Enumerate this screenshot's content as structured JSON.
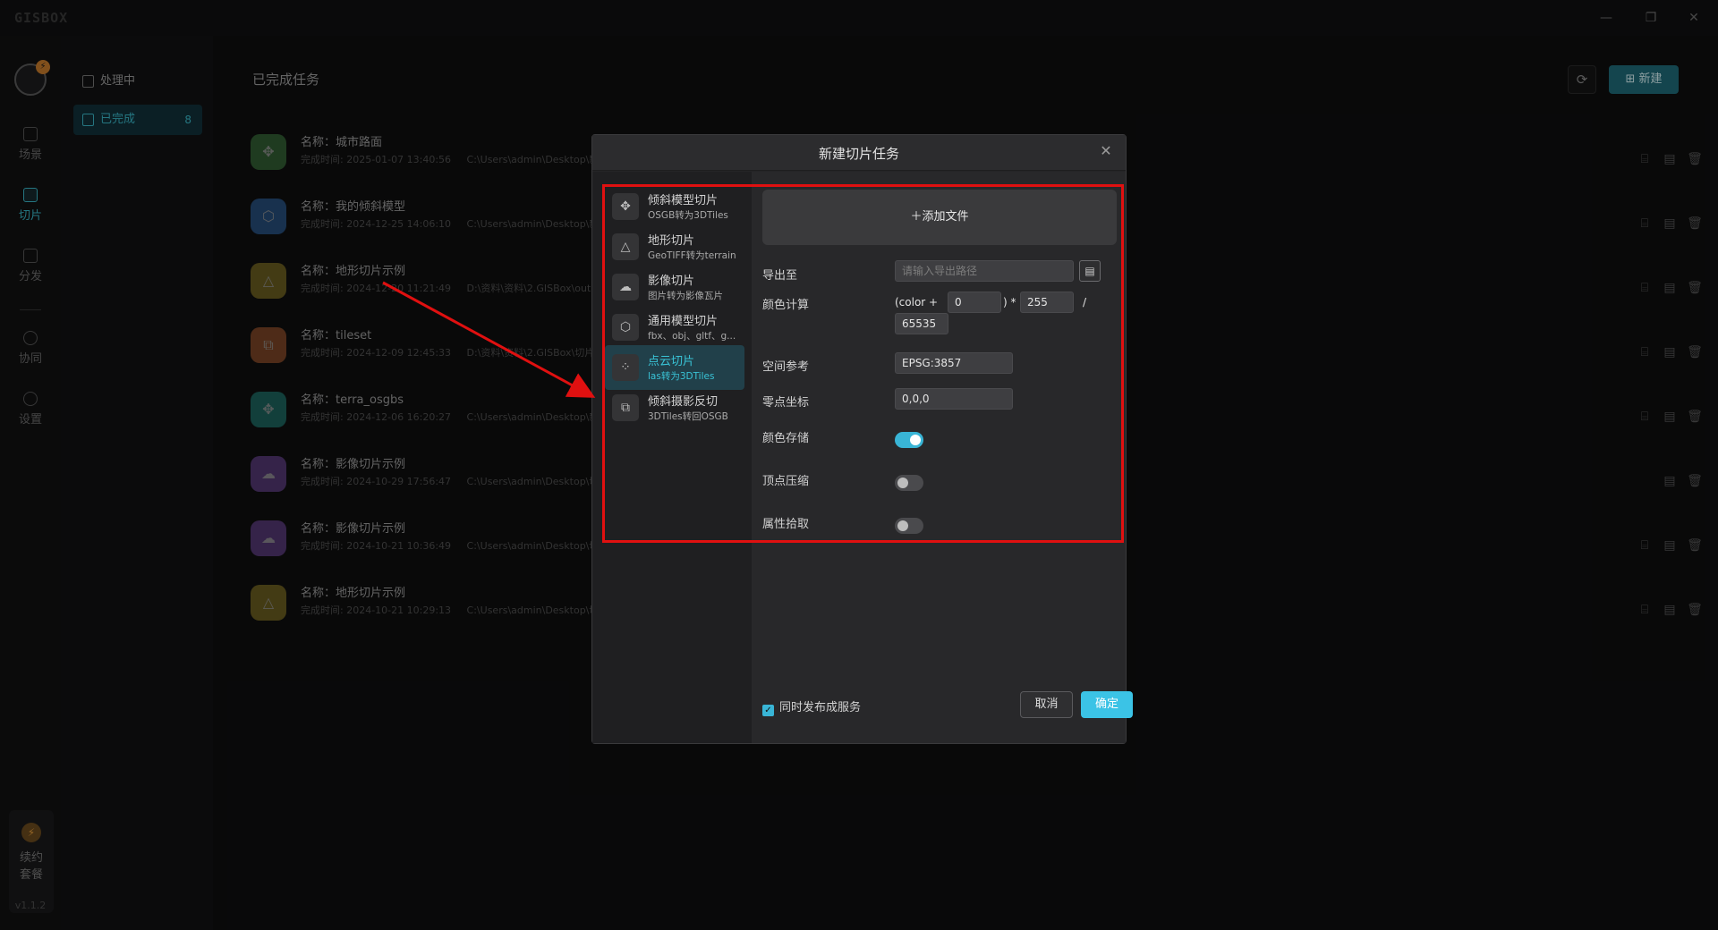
{
  "app": {
    "logo": "GISBOX",
    "window_controls": {
      "minimize": "—",
      "restore": "❐",
      "close": "✕"
    },
    "version": "v1.1.2"
  },
  "rail": {
    "items": [
      {
        "label": "场景",
        "icon": "scene-icon"
      },
      {
        "label": "切片",
        "icon": "slice-icon",
        "active": true
      },
      {
        "label": "分发",
        "icon": "distribute-icon"
      },
      {
        "label": "协同",
        "icon": "collab-icon"
      },
      {
        "label": "设置",
        "icon": "settings-icon"
      }
    ],
    "renew_label_1": "续约",
    "renew_label_2": "套餐"
  },
  "subnav": {
    "processing": "处理中",
    "done": "已完成",
    "done_count": "8"
  },
  "main": {
    "title": "已完成任务",
    "new_label": "新建",
    "time_label": "完成时间:",
    "tasks": [
      {
        "name": "名称：城市路面",
        "time": "2025-01-07 13:40:56",
        "path": "C:\\Users\\admin\\Desktop\\新建",
        "color": "#4f9a4f",
        "glyph": "✥",
        "actions": 3
      },
      {
        "name": "名称：我的倾斜模型",
        "time": "2024-12-25 14:06:10",
        "path": "C:\\Users\\admin\\Desktop\\新建",
        "color": "#3a7fd0",
        "glyph": "⬡",
        "actions": 3
      },
      {
        "name": "名称：地形切片示例",
        "time": "2024-12-20 11:21:49",
        "path": "D:\\资料\\资料\\2.GISBox\\out",
        "color": "#b19a2e",
        "glyph": "△",
        "actions": 3
      },
      {
        "name": "名称：tileset",
        "time": "2024-12-09 12:45:33",
        "path": "D:\\资料\\资料\\2.GISBox\\切片\\",
        "color": "#d0703a",
        "glyph": "⧉",
        "actions": 3
      },
      {
        "name": "名称：terra_osgbs",
        "time": "2024-12-06 16:20:27",
        "path": "C:\\Users\\admin\\Desktop\\新建",
        "color": "#2aa89a",
        "glyph": "✥",
        "actions": 3
      },
      {
        "name": "名称：影像切片示例",
        "time": "2024-10-29 17:56:47",
        "path": "C:\\Users\\admin\\Desktop\\切片",
        "color": "#8a5ac0",
        "glyph": "☁",
        "actions": 2
      },
      {
        "name": "名称：影像切片示例",
        "time": "2024-10-21 10:36:49",
        "path": "C:\\Users\\admin\\Desktop\\切片",
        "color": "#8a5ac0",
        "glyph": "☁",
        "actions": 3
      },
      {
        "name": "名称：地形切片示例",
        "time": "2024-10-21 10:29:13",
        "path": "C:\\Users\\admin\\Desktop\\切片\\",
        "color": "#b19a2e",
        "glyph": "△",
        "actions": 3
      }
    ]
  },
  "dialog": {
    "title": "新建切片任务",
    "options": [
      {
        "title": "倾斜模型切片",
        "sub": "OSGB转为3DTiles",
        "glyph": "✥"
      },
      {
        "title": "地形切片",
        "sub": "GeoTIFF转为terrain",
        "glyph": "△"
      },
      {
        "title": "影像切片",
        "sub": "图片转为影像瓦片",
        "glyph": "☁"
      },
      {
        "title": "通用模型切片",
        "sub": "fbx、obj、gltf、g...",
        "glyph": "⬡"
      },
      {
        "title": "点云切片",
        "sub": "las转为3DTiles",
        "glyph": "⁘",
        "active": true
      },
      {
        "title": "倾斜摄影反切",
        "sub": "3DTiles转回OSGB",
        "glyph": "⧉"
      }
    ],
    "add_file": "＋添加文件",
    "export_label": "导出至",
    "export_placeholder": "请输入导出路径",
    "color_calc_label": "颜色计算",
    "color_calc_prefix": "(color +",
    "color_calc_a": "0",
    "color_calc_mid": ") *",
    "color_calc_b": "255",
    "color_calc_div": "/",
    "color_calc_c": "65535",
    "srs_label": "空间参考",
    "srs_value": "EPSG:3857",
    "origin_label": "零点坐标",
    "origin_value": "0,0,0",
    "color_store_label": "颜色存储",
    "color_store_on": true,
    "vertex_compress_label": "顶点压缩",
    "vertex_compress_on": false,
    "attr_pick_label": "属性拾取",
    "attr_pick_on": false,
    "publish_label": "同时发布成服务",
    "publish_checked": true,
    "cancel": "取消",
    "ok": "确定"
  },
  "colors": {
    "accent": "#39b5d6",
    "annotation": "#e01010"
  }
}
